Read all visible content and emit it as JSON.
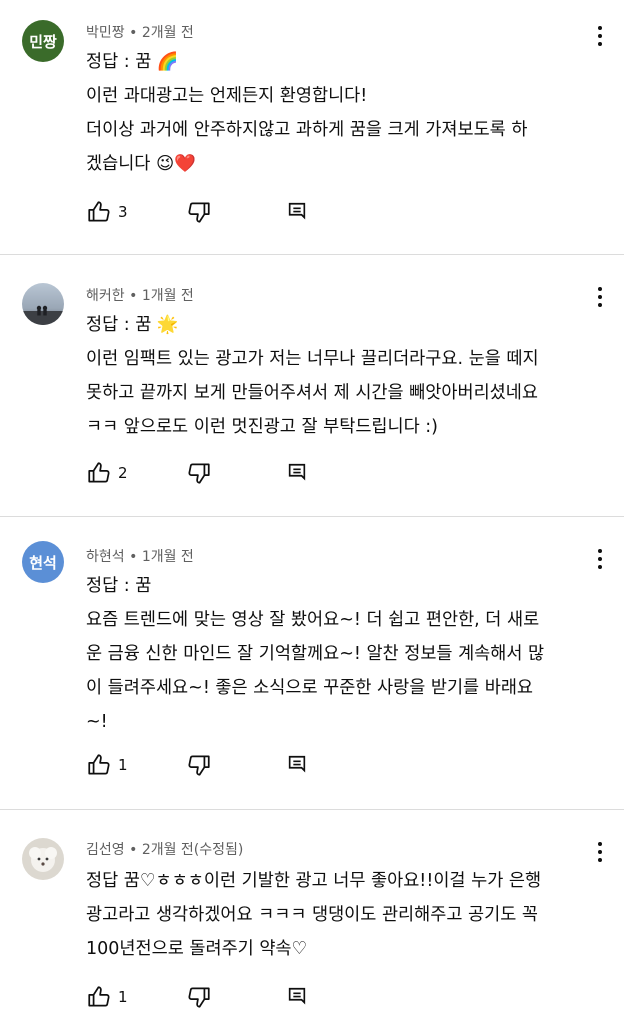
{
  "comments": [
    {
      "author": "박민짱",
      "time": "2개월 전",
      "avatar_text": "민짱",
      "avatar_color": "#3a6b2a",
      "lines": [
        "정답 : 꿈 🌈",
        "이런 과대광고는 언제든지 환영합니다!",
        "더이상 과거에 안주하지않고 과하게 꿈을 크게 가져보도록 하",
        "겠습니다 😉❤️"
      ],
      "likes": "3"
    },
    {
      "author": "해커한",
      "time": "1개월 전",
      "avatar_text": "",
      "avatar_color": "#6a7a8c",
      "lines": [
        "정답 : 꿈 🌟",
        "이런 임팩트 있는 광고가 저는 너무나 끌리더라구요. 눈을 떼지",
        "못하고 끝까지 보게 만들어주셔서 제 시간을 빼앗아버리셨네요",
        "ㅋㅋ 앞으로도 이런 멋진광고 잘 부탁드립니다 :)"
      ],
      "likes": "2"
    },
    {
      "author": "하현석",
      "time": "1개월 전",
      "avatar_text": "현석",
      "avatar_color": "#5b8fd6",
      "lines": [
        "정답 : 꿈",
        "요즘 트렌드에 맞는 영상 잘 봤어요~! 더 쉽고 편안한, 더 새로",
        "운 금융 신한 마인드 잘 기억할께요~! 알찬 정보들 계속해서 많",
        "이 들려주세요~! 좋은 소식으로 꾸준한 사랑을 받기를 바래요",
        "~!"
      ],
      "likes": "1"
    },
    {
      "author": "김선영",
      "time": "2개월 전(수정됨)",
      "avatar_text": "",
      "avatar_color": "#dcd8d0",
      "lines": [
        "정답 꿈♡ㅎㅎㅎ이런 기발한 광고 너무 좋아요!!이걸 누가 은행",
        "광고라고 생각하겠어요 ㅋㅋㅋ 댕댕이도 관리해주고 공기도 꼭",
        "100년전으로 돌려주기 약속♡"
      ],
      "likes": "1"
    }
  ]
}
